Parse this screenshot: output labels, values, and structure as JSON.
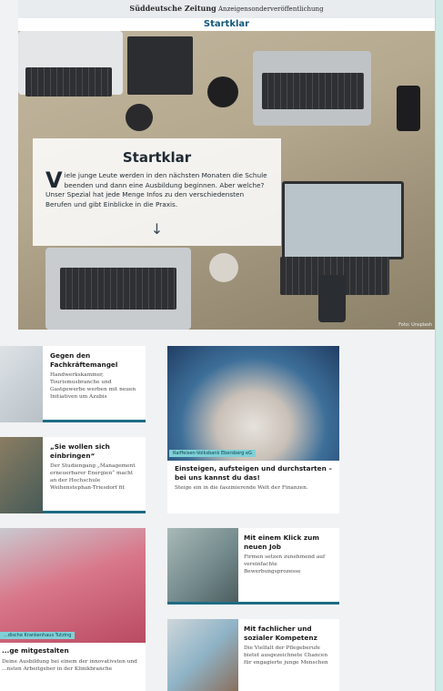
{
  "header": {
    "publisher": "Süddeutsche Zeitung",
    "publisher_note": "Anzeigensonderveröffentlichung",
    "logo": "Startklar"
  },
  "hero": {
    "title": "Startklar",
    "drop_cap": "V",
    "intro": "iele junge Leute werden in den nächsten Monaten die Schule beenden und dann eine Ausbildung beginnen. Aber welche? Unser Spezial hat jede Menge Infos zu den verschiedensten Berufen und gibt Einblicke in die Praxis.",
    "arrow_icon": "chevron-down-icon",
    "photo_credit": "Foto: Unsplash"
  },
  "cards": [
    {
      "title": "Gegen den Fachkräftemangel",
      "text": "Handwerkskammer, Tourismusbranche und Gastgewerbe werben mit neuen Initiativen um Azubis"
    },
    {
      "title": "„Sie wollen sich einbringen“",
      "text": "Der Studiengang „Management erneuerbarer Energien“ macht an der Hochschule Weihenstephan-Triesdorf fit"
    },
    {
      "tag": "Raiffeisen-Volksbank Ebersberg eG",
      "title": "Einsteigen, aufsteigen und durchstarten – bei uns kannst du das!",
      "text": "Steige ein in die faszinierende Welt der Finanzen."
    },
    {
      "tag": "...dische Krankenhaus Tutzing",
      "title": "...ge mitgestalten",
      "text": "Deine Ausbildung bei einem der innovativsten und ...nsten Arbeitgeber in der Klinikbranche"
    },
    {
      "title": "Mit einem Klick zum neuen Job",
      "text": "Firmen setzen zunehmend auf vereinfachte Bewerbungsprozesse"
    },
    {
      "title": "Mit fachlicher und sozialer Kompetenz",
      "text": "Die Vielfalt der Pflegeberufe bietet ausgezeichnete Chancen für engagierte junge Menschen"
    }
  ],
  "colors": {
    "accent": "#1e6b83",
    "tag": "#7fd1d7",
    "background": "#f1f2f4"
  }
}
